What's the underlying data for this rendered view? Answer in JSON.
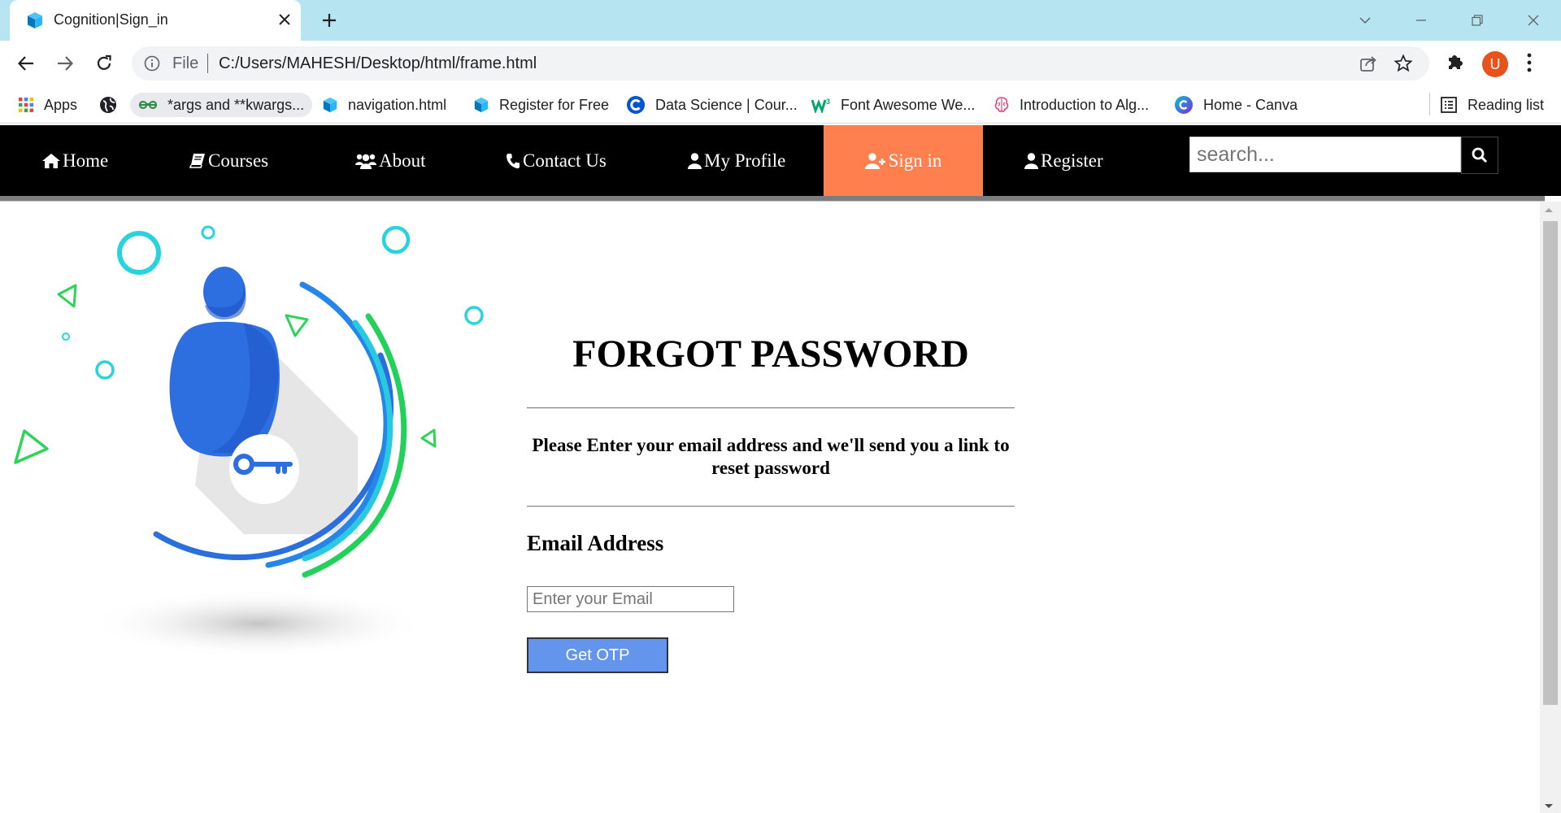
{
  "browser": {
    "tab": {
      "title": "Cognition|Sign_in",
      "favicon": "cube-icon"
    },
    "toolbar": {
      "omnibox": {
        "scheme_label": "File",
        "url": "C:/Users/MAHESH/Desktop/html/frame.html"
      },
      "avatar_initial": "U"
    },
    "bookmarks": [
      {
        "label": "Apps",
        "icon": "apps-grid-icon"
      },
      {
        "label": "",
        "icon": "globe-icon"
      },
      {
        "label": "*args and **kwargs...",
        "icon": "geeksforgeeks-icon"
      },
      {
        "label": "navigation.html",
        "icon": "cube-icon"
      },
      {
        "label": "Register for Free",
        "icon": "cube-icon"
      },
      {
        "label": "Data Science | Cour...",
        "icon": "c-logo-icon"
      },
      {
        "label": "Font Awesome We...",
        "icon": "w3schools-icon"
      },
      {
        "label": "Introduction to Alg...",
        "icon": "brain-icon"
      },
      {
        "label": "Home - Canva",
        "icon": "canva-icon"
      }
    ],
    "reading_list": "Reading list"
  },
  "site": {
    "nav": [
      {
        "label": "Home",
        "icon": "home-icon"
      },
      {
        "label": " Courses",
        "icon": "book-icon"
      },
      {
        "label": "About",
        "icon": "users-icon"
      },
      {
        "label": "Contact Us",
        "icon": "phone-icon"
      },
      {
        "label": "My Profile",
        "icon": "user-icon"
      },
      {
        "label": "Sign in",
        "icon": "user-plus-icon",
        "active": true
      },
      {
        "label": "Register",
        "icon": "user-icon"
      }
    ],
    "search": {
      "placeholder": "search..."
    },
    "colors": {
      "nav_bg": "#000000",
      "active_bg": "#ff7f4f",
      "button_bg": "#6495ed"
    }
  },
  "form": {
    "title": "FORGOT PASSWORD",
    "message": "Please Enter your email address and we'll send you a link to reset password",
    "email_label": "Email Address",
    "email_placeholder": "Enter your Email",
    "email_value": "",
    "submit_label": "Get OTP"
  }
}
